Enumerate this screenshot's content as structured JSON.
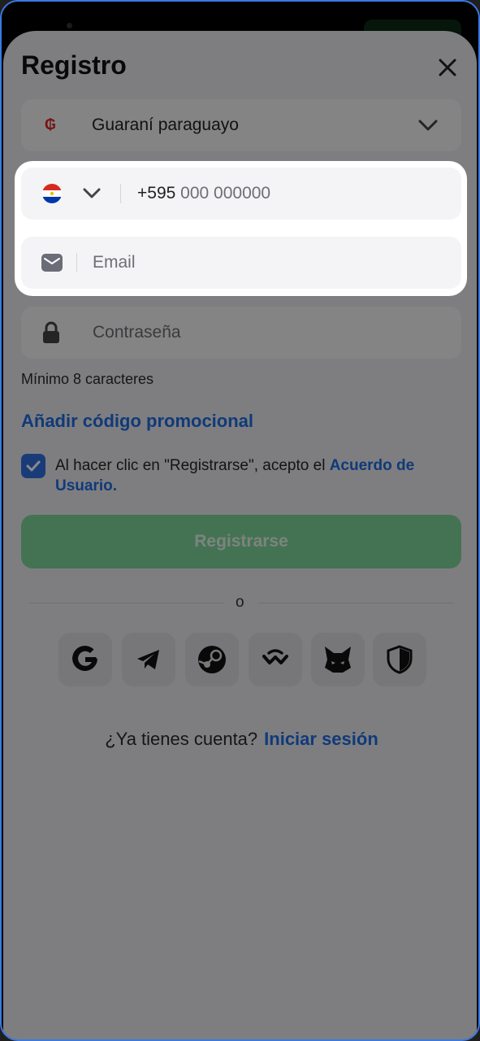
{
  "header": {
    "title": "Registro"
  },
  "currency": {
    "label": "Guaraní paraguayo",
    "symbol": "₲"
  },
  "phone": {
    "prefix": "+595",
    "placeholder": "000 000000",
    "flag": "paraguay-flag"
  },
  "email": {
    "placeholder": "Email"
  },
  "password": {
    "placeholder": "Contraseña",
    "hint": "Mínimo 8 caracteres"
  },
  "promo": {
    "label": "Añadir código promocional"
  },
  "agreement": {
    "text": "Al hacer clic en \"Registrarse\", acepto el ",
    "link": "Acuerdo de Usuario",
    "end": ".",
    "checked": true
  },
  "register": {
    "label": "Registrarse"
  },
  "separator": {
    "label": "o"
  },
  "social": [
    "google-icon",
    "telegram-icon",
    "steam-icon",
    "walletconnect-icon",
    "metamask-icon",
    "shield-icon"
  ],
  "login": {
    "prompt": "¿Ya tienes cuenta?",
    "link": "Iniciar sesión"
  },
  "colors": {
    "accent": "#1e6be0",
    "primary_button": "#7fd49a",
    "field_bg": "#f4f4f6"
  }
}
